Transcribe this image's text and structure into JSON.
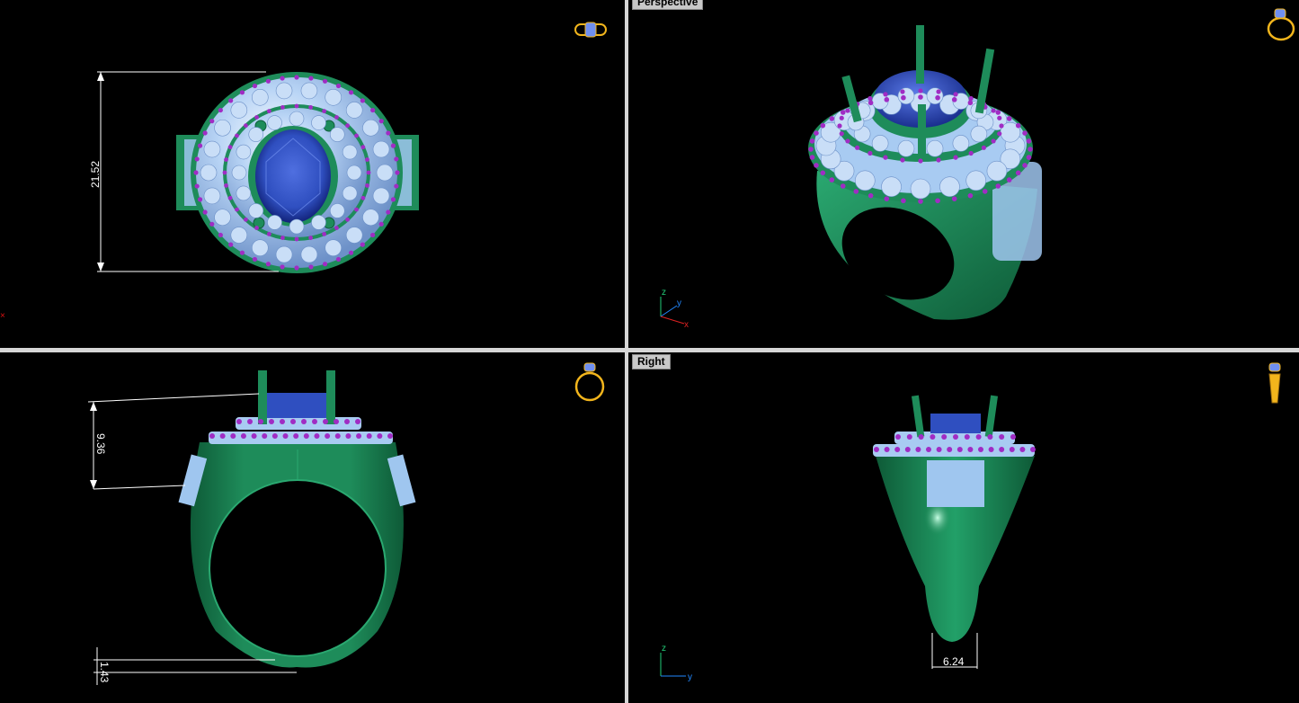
{
  "viewports": {
    "top": {
      "dimension": "21.52"
    },
    "perspective": {
      "title": "Perspective",
      "axes": {
        "x": "x",
        "y": "y",
        "z": "z"
      }
    },
    "front": {
      "dimension_height": "9.36",
      "dimension_band": "1.43"
    },
    "right": {
      "title": "Right",
      "dimension_width": "6.24",
      "axes": {
        "y": "y",
        "z": "z"
      }
    }
  },
  "colors": {
    "background": "#000000",
    "metal": "#1e8c5a",
    "gem_center": "#2f4fc0",
    "gem_side": "#a8cbf2",
    "prongs_small": "#a02cc4",
    "dimension_lines": "#ffffff",
    "view_icon": "#f2b51c",
    "separator": "#d6d6d6"
  },
  "icons": [
    "ring-top-view-icon",
    "ring-perspective-view-icon",
    "ring-front-view-icon",
    "ring-right-view-icon"
  ]
}
